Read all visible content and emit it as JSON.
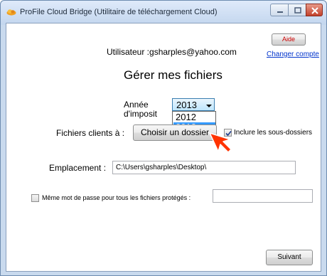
{
  "window": {
    "title": "ProFile Cloud Bridge (Utilitaire de téléchargement Cloud)"
  },
  "header": {
    "user_text": "Utilisateur :gsharples@yahoo.com",
    "aide_label": "Aide",
    "change_account_link": "Changer compte",
    "section_title": "Gérer mes fichiers"
  },
  "tax_year": {
    "label_line1": "Année",
    "label_line2": "d'imposit",
    "selected_value": "2013",
    "options": [
      {
        "label": "2012",
        "selected": false
      },
      {
        "label": "2013",
        "selected": true
      }
    ]
  },
  "client_files": {
    "label": "Fichiers clients à :",
    "choose_folder_button": "Choisir un dossier",
    "include_subfolders_label": "Inclure les sous-dossiers",
    "include_subfolders_checked": true
  },
  "location": {
    "label": "Emplacement :",
    "value": "C:\\Users\\gsharples\\Desktop\\"
  },
  "password": {
    "label": "Même mot de passe pour tous les fichiers protégés :",
    "checked": false,
    "value": ""
  },
  "footer": {
    "next_button": "Suivant"
  },
  "colors": {
    "link": "#0033cc",
    "aide_text": "#cc0000",
    "pointer_arrow": "#ff3300",
    "selection": "#3399ff"
  },
  "icons": {
    "app": "profile-cloud-icon",
    "pointer": "red-pointer-arrow-icon"
  }
}
